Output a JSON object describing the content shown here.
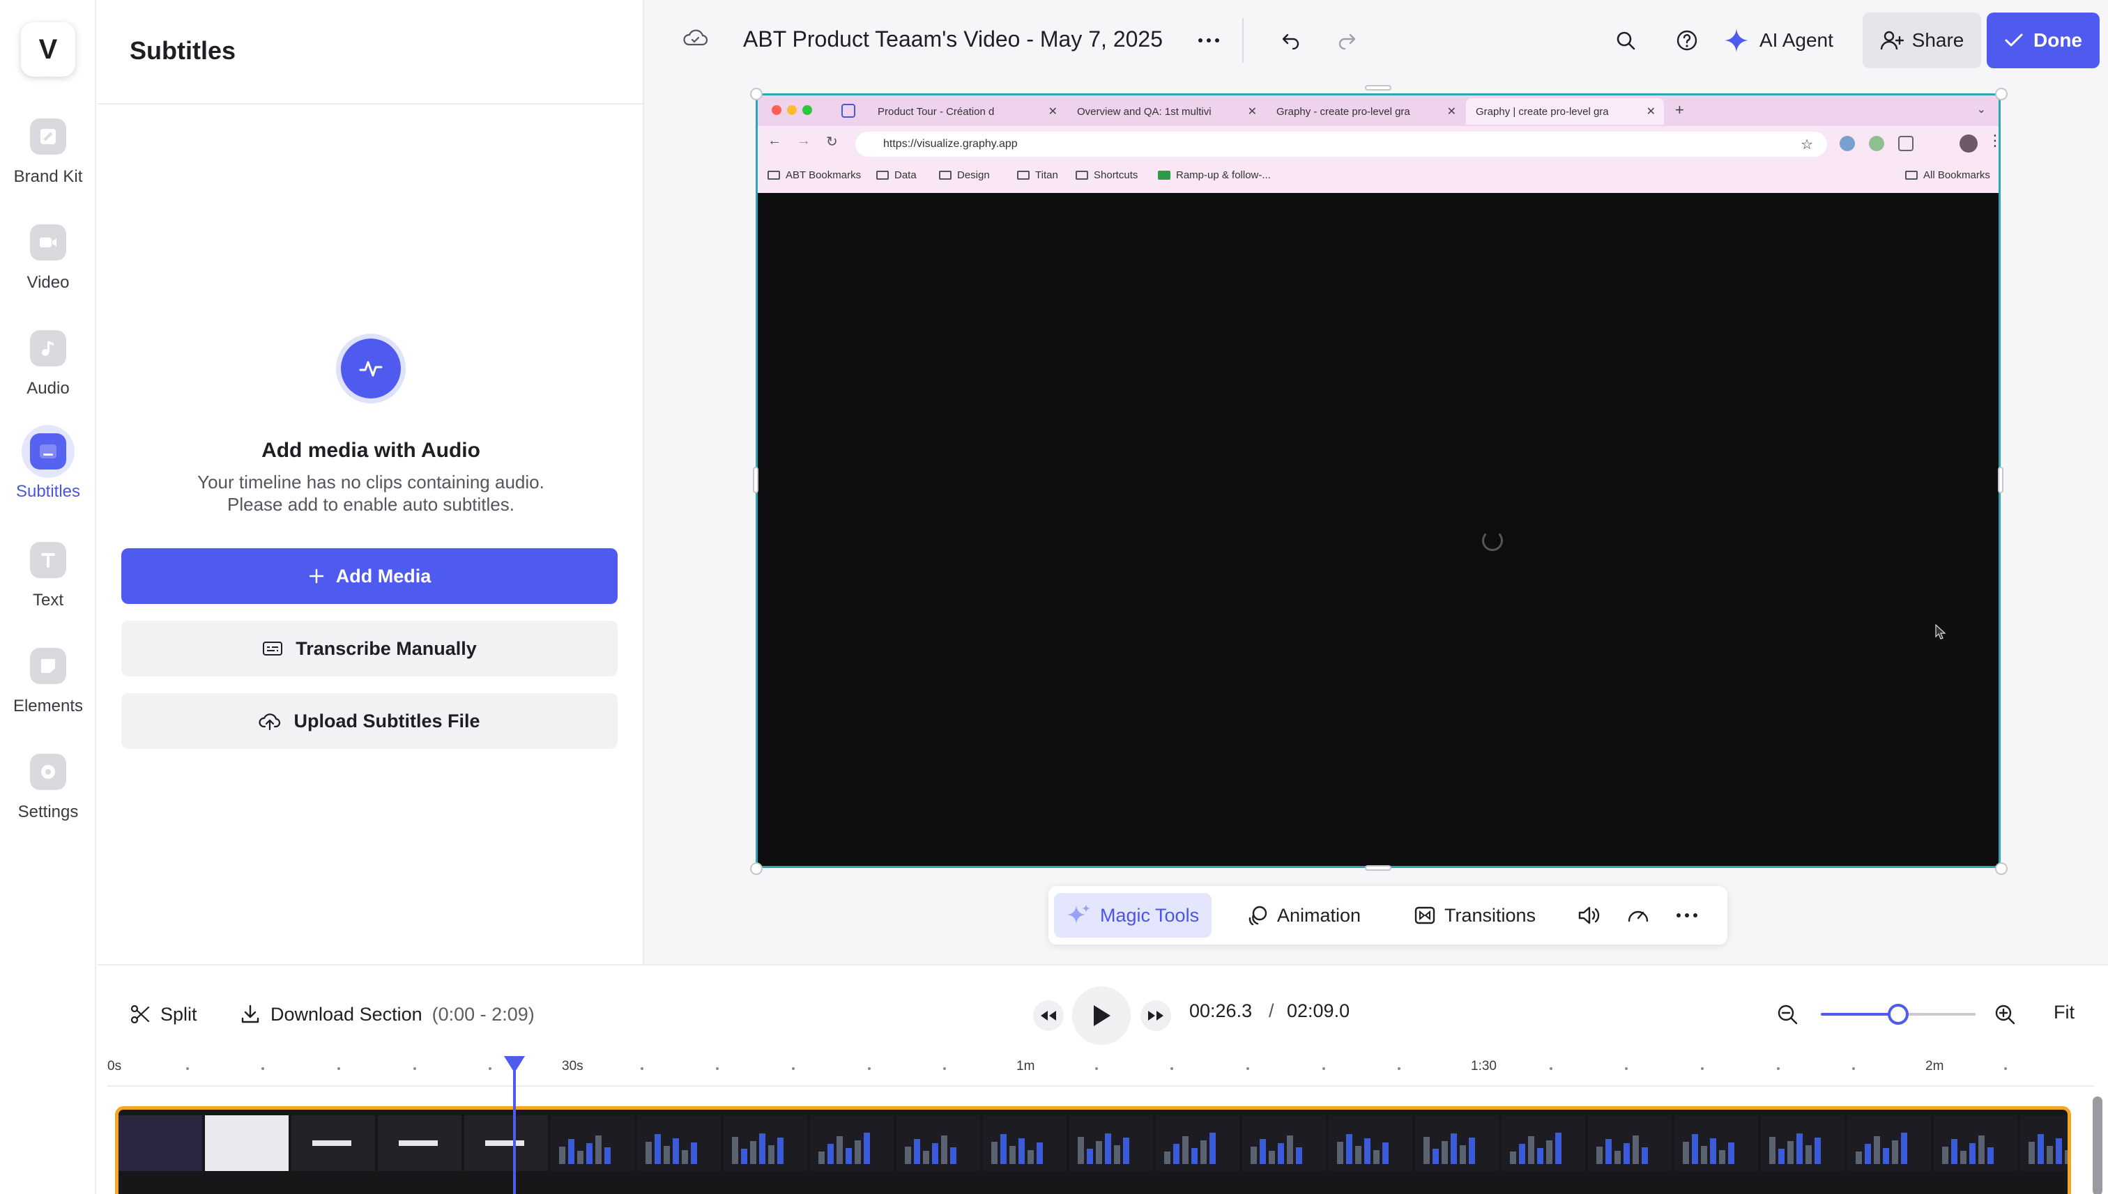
{
  "app": {
    "logo_letter": "V"
  },
  "rail": {
    "items": [
      {
        "label": "Brand Kit",
        "icon": "brand-kit-icon"
      },
      {
        "label": "Video",
        "icon": "video-icon"
      },
      {
        "label": "Audio",
        "icon": "audio-icon"
      },
      {
        "label": "Subtitles",
        "icon": "subtitles-icon",
        "active": true
      },
      {
        "label": "Text",
        "icon": "text-icon"
      },
      {
        "label": "Elements",
        "icon": "elements-icon"
      },
      {
        "label": "Settings",
        "icon": "settings-icon"
      }
    ]
  },
  "panel": {
    "title": "Subtitles",
    "empty_title": "Add media with Audio",
    "empty_desc_line1": "Your timeline has no clips containing audio.",
    "empty_desc_line2": "Please add to enable auto subtitles.",
    "add_media": "Add Media",
    "transcribe": "Transcribe Manually",
    "upload": "Upload Subtitles File"
  },
  "topbar": {
    "title": "ABT Product Teaam's Video - May 7, 2025",
    "ai_agent": "AI Agent",
    "share": "Share",
    "done": "Done"
  },
  "browser": {
    "tabs": [
      {
        "label": "Product Tour - Création d",
        "active": false
      },
      {
        "label": "Overview and QA: 1st multivi",
        "active": false
      },
      {
        "label": "Graphy - create pro-level gra",
        "active": false
      },
      {
        "label": "Graphy | create pro-level gra",
        "active": true
      }
    ],
    "url": "https://visualize.graphy.app",
    "bookmarks": [
      "ABT Bookmarks",
      "Data",
      "Design",
      "Titan",
      "Shortcuts",
      "Ramp-up & follow-..."
    ],
    "all_bookmarks": "All Bookmarks"
  },
  "tools": {
    "magic": "Magic Tools",
    "animation": "Animation",
    "transitions": "Transitions"
  },
  "timeline": {
    "split": "Split",
    "download": "Download Section",
    "range": "(0:00 - 2:09)",
    "current_time": "00:26.3",
    "separator": "/",
    "total_time": "02:09.0",
    "fit": "Fit",
    "zoom_level": 0.5,
    "playhead_seconds": 26.3,
    "ruler_labels": [
      "0s",
      "30s",
      "1m",
      "1:30",
      "2m"
    ]
  },
  "colors": {
    "accent": "#4f5bee",
    "track_border": "#f5a623",
    "frame_border": "#2aa6b4"
  }
}
